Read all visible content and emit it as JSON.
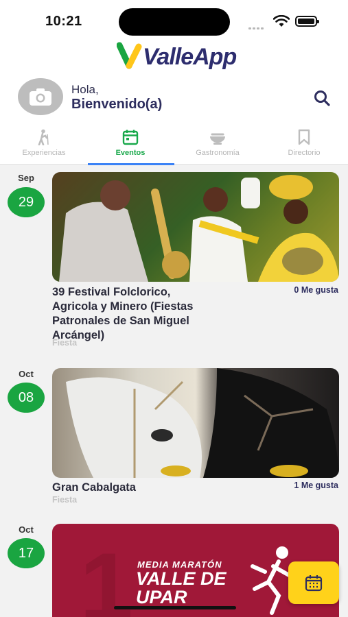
{
  "status": {
    "time": "10:21"
  },
  "app": {
    "logo_text": "ValleApp"
  },
  "greeting": {
    "hello": "Hola,",
    "name": "Bienvenido(a)"
  },
  "tabs": [
    {
      "label": "Experiencias",
      "icon": "hiker-icon",
      "active": false
    },
    {
      "label": "Eventos",
      "icon": "calendar-icon",
      "active": true
    },
    {
      "label": "Gastronomía",
      "icon": "dish-icon",
      "active": false
    },
    {
      "label": "Directorio",
      "icon": "bookmark-icon",
      "active": false
    }
  ],
  "events": [
    {
      "month": "Sep",
      "day": "29",
      "title": "39 Festival Folclorico, Agricola y Minero (Fiestas Patronales de San Miguel Arcángel)",
      "likes": "0 Me gusta",
      "category": "Fiesta"
    },
    {
      "month": "Oct",
      "day": "08",
      "title": "Gran Cabalgata",
      "likes": "1 Me gusta",
      "category": "Fiesta"
    },
    {
      "month": "Oct",
      "day": "17",
      "title": "",
      "likes": "",
      "category": "",
      "poster": {
        "line1": "MEDIA MARATÓN",
        "line2": "VALLE DE",
        "line3": "UPAR"
      }
    }
  ],
  "colors": {
    "accent_green": "#1aa541",
    "tab_underline": "#3b82f6",
    "fab": "#ffd21a",
    "brand_navy": "#2d2d6e"
  }
}
